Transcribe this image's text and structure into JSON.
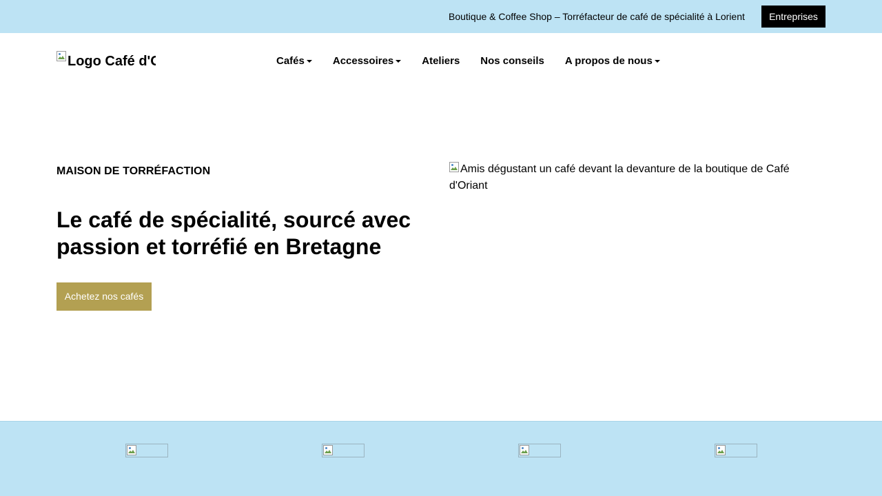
{
  "topbar": {
    "tagline": "Boutique & Coffee Shop – Torréfacteur de café de spécialité à Lorient",
    "business_button": "Entreprises"
  },
  "header": {
    "logo_alt": "Logo Café d'Oriant",
    "nav": [
      {
        "label": "Cafés",
        "dropdown": true
      },
      {
        "label": "Accessoires",
        "dropdown": true
      },
      {
        "label": "Ateliers",
        "dropdown": false
      },
      {
        "label": "Nos conseils",
        "dropdown": false
      },
      {
        "label": "A propos de nous",
        "dropdown": true
      }
    ]
  },
  "hero": {
    "eyebrow": "MAISON DE TORRÉFACTION",
    "headline": "Le café de spécialité, sourcé avec passion et torréfié en Bretagne",
    "cta": "Achetez nos cafés",
    "image_alt": "Amis dégustant un café devant la devanture de la boutique de Café d'Oriant"
  },
  "footer": {
    "badges": [
      "broken-image-icon",
      "broken-image-icon",
      "broken-image-icon",
      "broken-image-icon"
    ]
  },
  "colors": {
    "topbar_bg": "#bde3f4",
    "cta_bg": "#b3a052",
    "business_button_bg": "#000000"
  }
}
